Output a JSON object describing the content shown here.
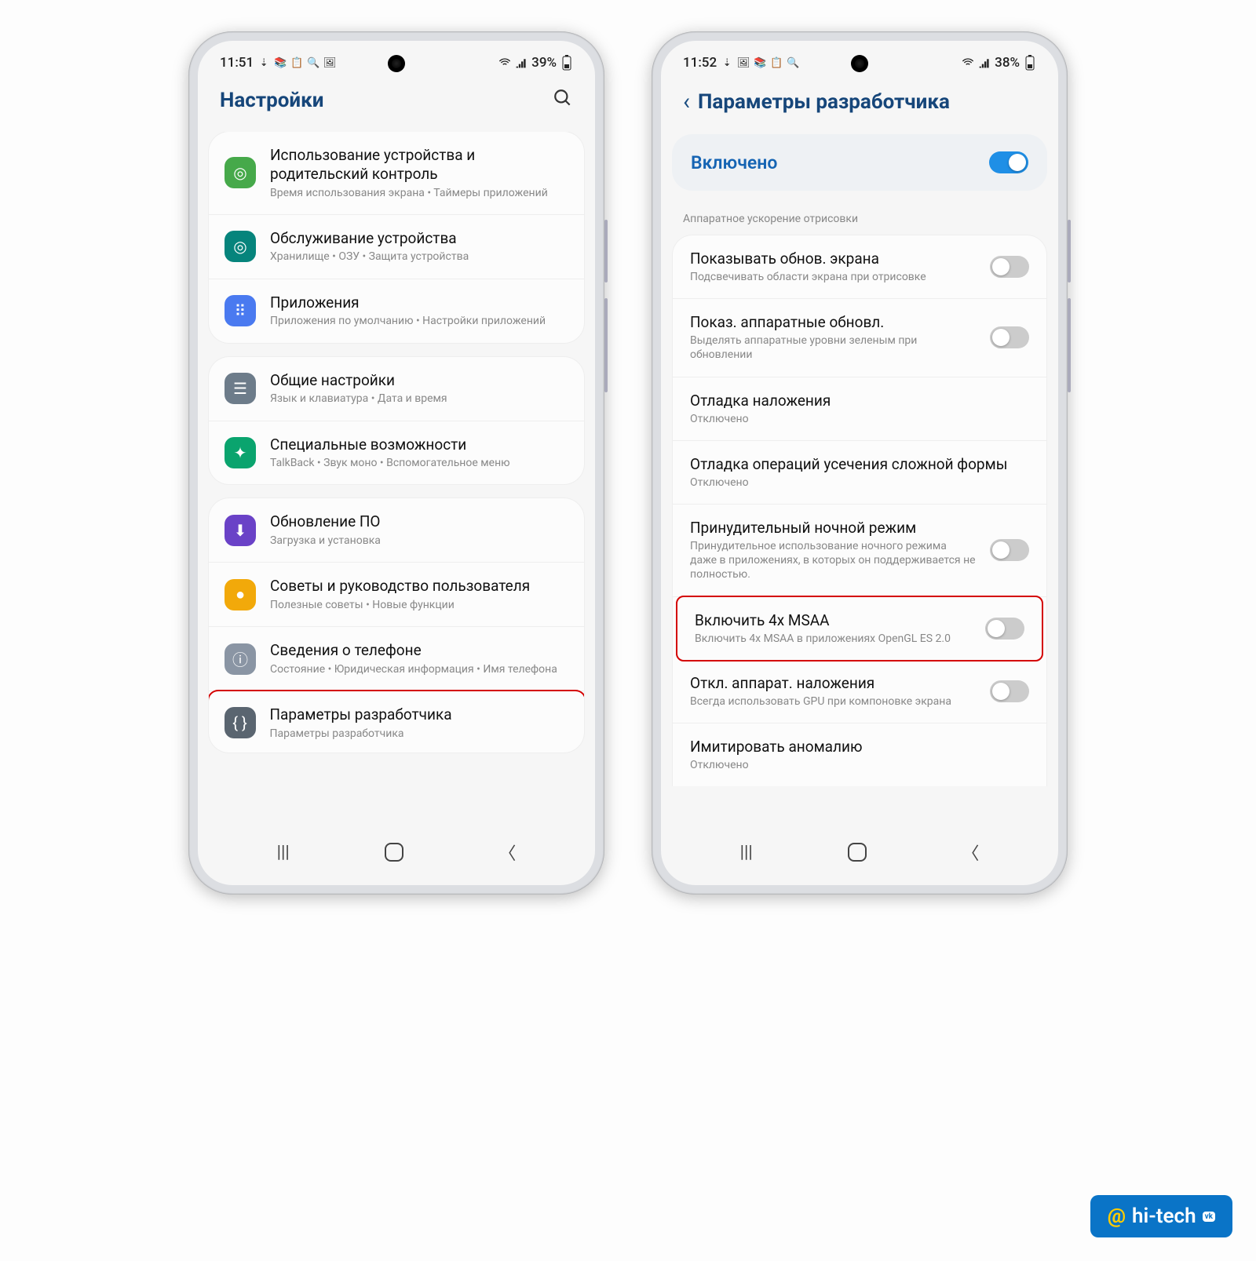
{
  "left": {
    "status": {
      "time": "11:51",
      "battery": "39%"
    },
    "header": {
      "title": "Настройки"
    },
    "groups": [
      [
        {
          "title": "Использование устройства и родительский контроль",
          "sub": "Время использования экрана  •  Таймеры приложений",
          "icon_bg": "#46a94a",
          "icon_glyph": "◎"
        },
        {
          "title": "Обслуживание устройства",
          "sub": "Хранилище  •  ОЗУ  •  Защита устройства",
          "icon_bg": "#06847c",
          "icon_glyph": "◎"
        },
        {
          "title": "Приложения",
          "sub": "Приложения по умолчанию  •  Настройки приложений",
          "icon_bg": "#4a7af0",
          "icon_glyph": "⠿"
        }
      ],
      [
        {
          "title": "Общие настройки",
          "sub": "Язык и клавиатура  •  Дата и время",
          "icon_bg": "#6d7c8a",
          "icon_glyph": "☰"
        },
        {
          "title": "Специальные возможности",
          "sub": "TalkBack  •  Звук моно  •  Вспомогательное меню",
          "icon_bg": "#0aa46e",
          "icon_glyph": "✦"
        }
      ],
      [
        {
          "title": "Обновление ПО",
          "sub": "Загрузка и установка",
          "icon_bg": "#6a42c7",
          "icon_glyph": "⬇"
        },
        {
          "title": "Советы и руководство пользователя",
          "sub": "Полезные советы  •  Новые функции",
          "icon_bg": "#f2a90a",
          "icon_glyph": "●"
        },
        {
          "title": "Сведения о телефоне",
          "sub": "Состояние  •  Юридическая информация  •  Имя телефона",
          "icon_bg": "#8a95a4",
          "icon_glyph": "ⓘ"
        },
        {
          "title": "Параметры разработчика",
          "sub": "Параметры разработчика",
          "icon_bg": "#5a6570",
          "icon_glyph": "{ }",
          "highlighted": true
        }
      ]
    ]
  },
  "right": {
    "status": {
      "time": "11:52",
      "battery": "38%"
    },
    "header": {
      "title": "Параметры разработчика"
    },
    "master_toggle": {
      "label": "Включено",
      "on": true
    },
    "section_title": "Аппаратное ускорение отрисовки",
    "items": [
      {
        "title": "Показывать обнов. экрана",
        "sub": "Подсвечивать области экрана при отрисовке",
        "toggle": false
      },
      {
        "title": "Показ. аппаратные обновл.",
        "sub": "Выделять аппаратные уровни зеленым при обновлении",
        "toggle": false
      },
      {
        "title": "Отладка наложения",
        "sub": "Отключено"
      },
      {
        "title": "Отладка операций усечения сложной формы",
        "sub": "Отключено"
      },
      {
        "title": "Принудительный ночной режим",
        "sub": "Принудительное использование ночного режима даже в приложениях, в которых он поддерживается не полностью.",
        "toggle": false
      },
      {
        "title": "Включить 4x MSAA",
        "sub": "Включить 4x MSAA в приложениях OpenGL ES 2.0",
        "toggle": false,
        "highlighted": true
      },
      {
        "title": "Откл. аппарат. наложения",
        "sub": "Всегда использовать GPU при компоновке экрана",
        "toggle": false
      },
      {
        "title": "Имитировать аномалию",
        "sub": "Отключено"
      }
    ]
  },
  "watermark": "hi-tech"
}
